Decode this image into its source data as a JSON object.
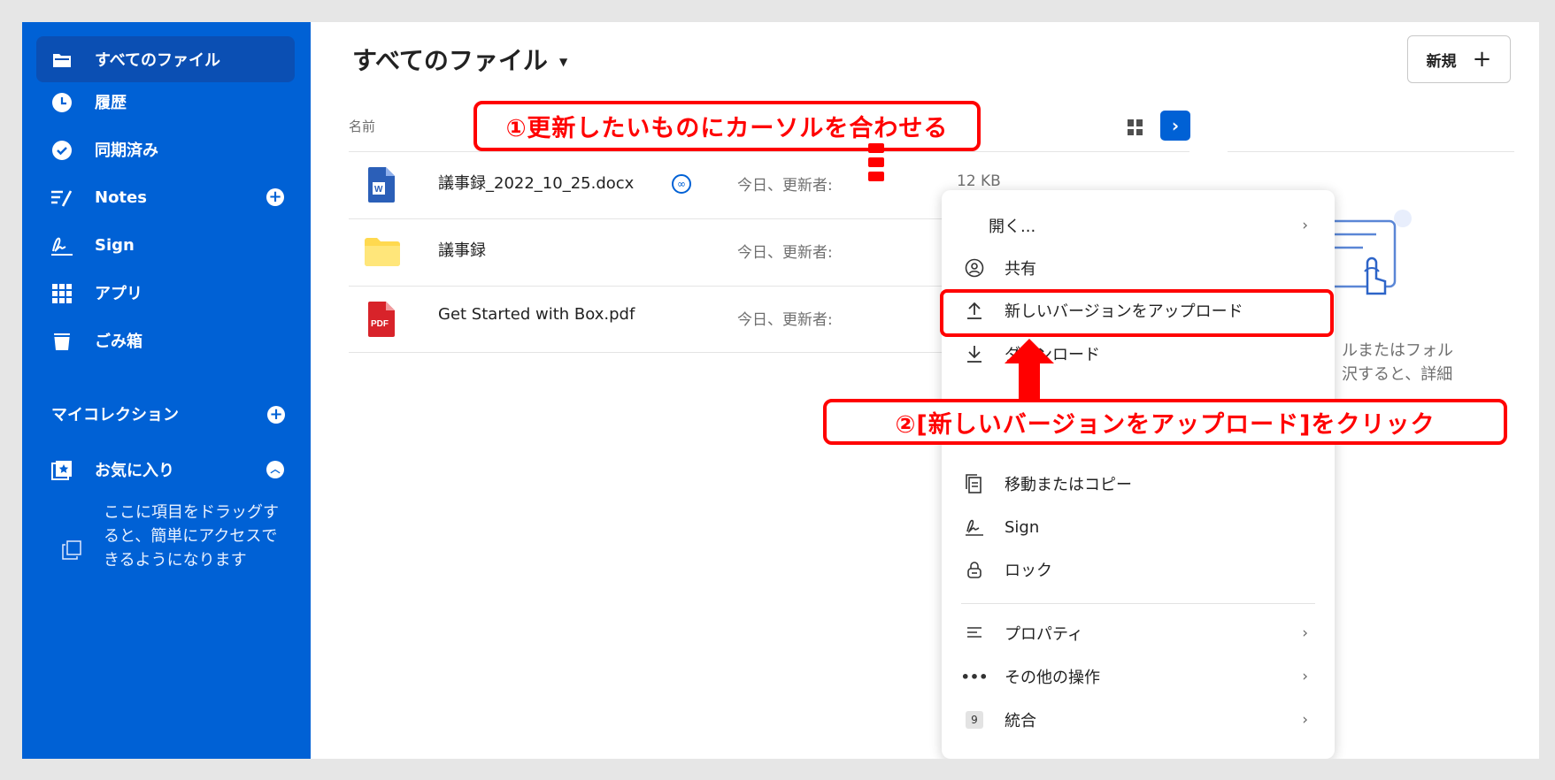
{
  "sidebar": {
    "items": [
      {
        "label": "すべてのファイル"
      },
      {
        "label": "履歴"
      },
      {
        "label": "同期済み"
      },
      {
        "label": "Notes"
      },
      {
        "label": "Sign"
      },
      {
        "label": "アプリ"
      },
      {
        "label": "ごみ箱"
      }
    ],
    "my_collection": "マイコレクション",
    "favorites": "お気に入り",
    "favorites_hint": "ここに項目をドラッグすると、簡単にアクセスできるようになります"
  },
  "header": {
    "title": "すべてのファイル",
    "new_button": "新規"
  },
  "file_list": {
    "column_name": "名前",
    "rows": [
      {
        "name": "議事録_2022_10_25.docx",
        "modified": "今日、更新者:",
        "size": "12 KB"
      },
      {
        "name": "議事録",
        "modified": "今日、更新者:"
      },
      {
        "name": "Get Started with Box.pdf",
        "modified": "今日、更新者:"
      }
    ]
  },
  "preview_panel": {
    "lines": [
      "ルまたはフォル",
      "沢すると、詳細"
    ]
  },
  "context_menu": {
    "items": [
      {
        "label": "開く..."
      },
      {
        "label": "共有"
      },
      {
        "label": "新しいバージョンをアップロード"
      },
      {
        "label": "ダウンロード"
      },
      {
        "label": "移動またはコピー"
      },
      {
        "label": "Sign"
      },
      {
        "label": "ロック"
      },
      {
        "label": "プロパティ"
      },
      {
        "label": "その他の操作"
      },
      {
        "label": "統合"
      }
    ],
    "integration_badge": "9"
  },
  "annotations": {
    "step1": "①更新したいものにカーソルを合わせる",
    "step2": "②[新しいバージョンをアップロード]をクリック",
    "color": "#ff0000"
  },
  "colors": {
    "sidebar": "#0061d5",
    "accent": "#0061d5"
  }
}
